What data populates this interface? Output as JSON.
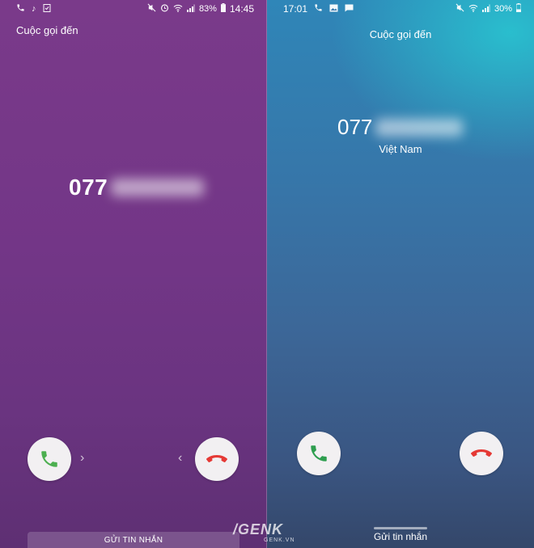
{
  "left_screen": {
    "status_bar": {
      "icons_left": [
        "phone-icon",
        "music-note-icon",
        "clipboard-icon"
      ],
      "icons_right": [
        "mute-icon",
        "alarm-icon",
        "wifi-icon",
        "signal-icon"
      ],
      "battery": "83%",
      "time": "14:45"
    },
    "title": "Cuộc gọi đến",
    "caller_number_visible": "077",
    "accept_icon": "phone-icon",
    "decline_icon": "phone-hangup-icon",
    "message_label": "GỬI TIN NHẮN",
    "accent": {
      "accept": "#4caf50",
      "decline": "#e53935"
    }
  },
  "right_screen": {
    "status_bar": {
      "time": "17:01",
      "icons_left": [
        "phone-icon",
        "image-icon",
        "message-icon"
      ],
      "icons_right": [
        "mute-icon",
        "wifi-icon",
        "signal-icon"
      ],
      "battery": "30%"
    },
    "title": "Cuộc gọi đến",
    "caller_number_visible": "077",
    "country": "Việt Nam",
    "message_label": "Gửi tin nhắn",
    "accent": {
      "accept": "#2e9e4f",
      "decline": "#e53935"
    }
  },
  "watermark": {
    "brand": "/GENK",
    "sub": "GENK.VN"
  }
}
